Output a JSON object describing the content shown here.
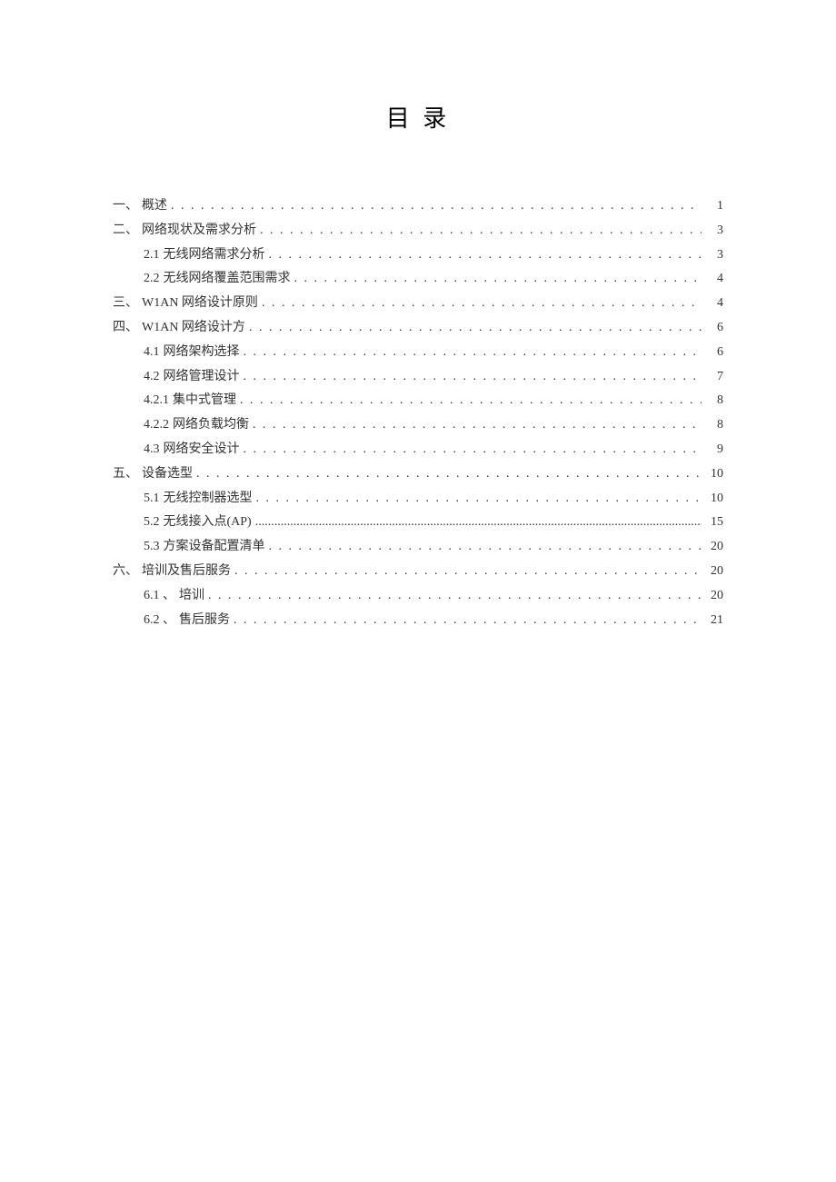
{
  "title": "目 录",
  "toc": [
    {
      "level": 1,
      "prefix": "一、",
      "text": "概述",
      "page": "1",
      "leader": "spaced"
    },
    {
      "level": 1,
      "prefix": "二、",
      "text": "网络现状及需求分析",
      "page": "3",
      "leader": "spaced"
    },
    {
      "level": 2,
      "prefix": "2.1",
      "text": " 无线网络需求分析",
      "page": "3",
      "leader": "spaced"
    },
    {
      "level": 2,
      "prefix": "2.2",
      "text": " 无线网络覆盖范围需求",
      "page": "4",
      "leader": "spaced"
    },
    {
      "level": 1,
      "prefix": "三、",
      "text": "W1AN 网络设计原则",
      "page": "4",
      "leader": "spaced"
    },
    {
      "level": 1,
      "prefix": "四、",
      "text": "W1AN 网络设计方",
      "page": "6",
      "leader": "spaced"
    },
    {
      "level": 2,
      "prefix": "4.1",
      "text": "  网络架构选择",
      "page": "6",
      "leader": "spaced"
    },
    {
      "level": 2,
      "prefix": "4.2",
      "text": "  网络管理设计",
      "page": "7",
      "leader": "spaced"
    },
    {
      "level": 2,
      "prefix": "4.2.1",
      "text": "  集中式管理",
      "page": "8",
      "leader": "spaced"
    },
    {
      "level": 2,
      "prefix": "4.2.2",
      "text": "  网络负载均衡",
      "page": "8",
      "leader": "spaced"
    },
    {
      "level": 2,
      "prefix": "4.3",
      "text": "  网络安全设计",
      "page": "9",
      "leader": "spaced"
    },
    {
      "level": 1,
      "prefix": "五、",
      "text": "设备选型",
      "page": "10",
      "leader": "spaced"
    },
    {
      "level": 2,
      "prefix": "5.1",
      "text": "  无线控制器选型",
      "page": "10",
      "leader": "spaced"
    },
    {
      "level": 2,
      "prefix": "5.2",
      "text": "  无线接入点(AP)",
      "page": "15",
      "leader": "dotted"
    },
    {
      "level": 2,
      "prefix": "5.3",
      "text": "  方案设备配置清单",
      "page": "20",
      "leader": "spaced"
    },
    {
      "level": 1,
      "prefix": "六、",
      "text": "培训及售后服务",
      "page": "20",
      "leader": "spaced"
    },
    {
      "level": 2,
      "prefix": "6.1 、",
      "text": " 培训",
      "page": "20",
      "leader": "spaced"
    },
    {
      "level": 2,
      "prefix": "6.2 、",
      "text": " 售后服务",
      "page": "21",
      "leader": "spaced"
    }
  ]
}
